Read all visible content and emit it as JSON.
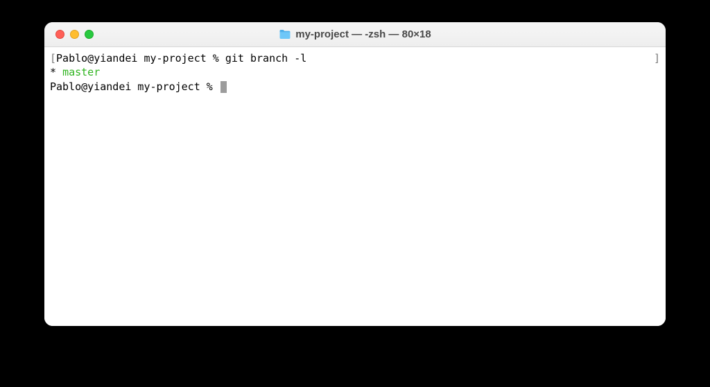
{
  "window": {
    "title": "my-project — -zsh — 80×18"
  },
  "terminal": {
    "line1_open_bracket": "[",
    "line1_prompt": "Pablo@yiandei my-project % ",
    "line1_command": "git branch -l",
    "line1_close_bracket": "]",
    "line2_marker": "* ",
    "line2_branch": "master",
    "line3_prompt": "Pablo@yiandei my-project % "
  }
}
